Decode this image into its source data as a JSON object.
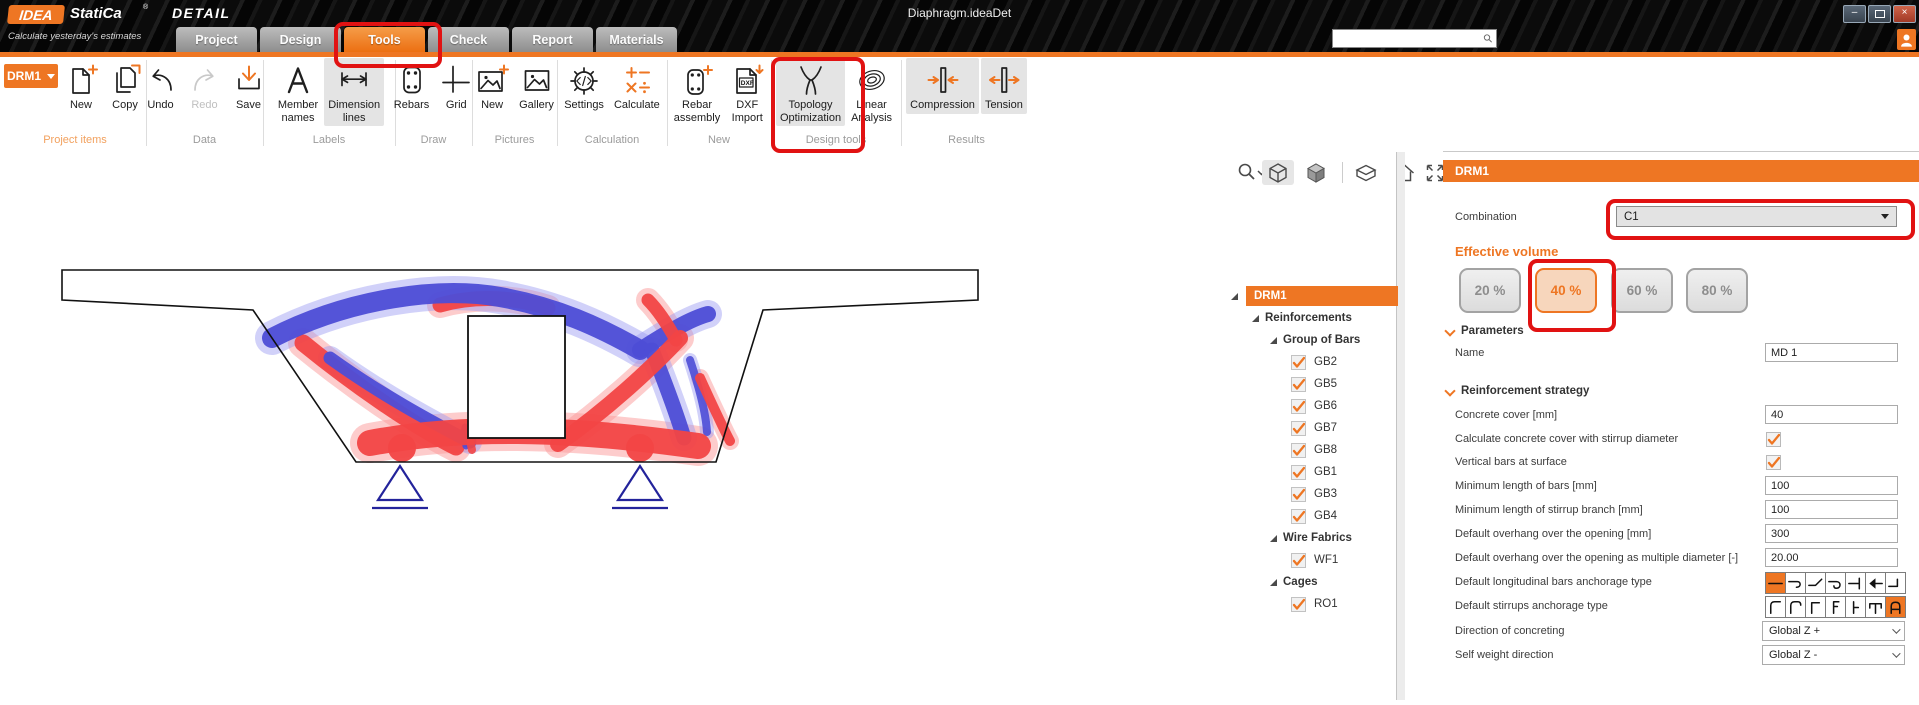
{
  "window": {
    "title": "Diaphragm.ideaDet",
    "controls": [
      {
        "name": "minimize",
        "glyph": "–"
      },
      {
        "name": "maximize",
        "glyph": "box"
      },
      {
        "name": "close",
        "glyph": "×"
      }
    ]
  },
  "brand": {
    "idea": "IDEA",
    "statica": "StatiCa",
    "reg": "®",
    "product": "DETAIL",
    "tagline": "Calculate yesterday's estimates"
  },
  "colors": {
    "accent_orange": "#ee7623",
    "annotation_red": "#e11212",
    "topology_red": "#f24545",
    "topology_blue": "#4d4dd6"
  },
  "tabs": [
    {
      "label": "Project",
      "active": false
    },
    {
      "label": "Design",
      "active": false
    },
    {
      "label": "Tools",
      "active": true
    },
    {
      "label": "Check",
      "active": false
    },
    {
      "label": "Report",
      "active": false
    },
    {
      "label": "Materials",
      "active": false
    }
  ],
  "search": {
    "value": ""
  },
  "ribbon": {
    "groups": [
      {
        "label": "Project items",
        "accent": true,
        "buttons": [
          {
            "label": "DRM1",
            "type": "dropdown"
          },
          {
            "label": "New",
            "icon": "new-document"
          },
          {
            "label": "Copy",
            "icon": "copy-document"
          }
        ]
      },
      {
        "label": "Data",
        "buttons": [
          {
            "label": "Undo",
            "icon": "undo-arrow"
          },
          {
            "label": "Redo",
            "icon": "redo-arrow",
            "disabled": true
          },
          {
            "label": "Save",
            "icon": "save-download"
          }
        ]
      },
      {
        "label": "Labels",
        "buttons": [
          {
            "label": "Member\nnames",
            "icon": "letter-a"
          },
          {
            "label": "Dimension\nlines",
            "icon": "dimension-arrow",
            "highlighted": true
          }
        ]
      },
      {
        "label": "Draw",
        "buttons": [
          {
            "label": "Rebars",
            "icon": "stirrup"
          },
          {
            "label": "Grid",
            "icon": "grid-cross"
          }
        ]
      },
      {
        "label": "Pictures",
        "buttons": [
          {
            "label": "New",
            "icon": "picture-new"
          },
          {
            "label": "Gallery",
            "icon": "picture"
          }
        ]
      },
      {
        "label": "Calculation",
        "buttons": [
          {
            "label": "Settings",
            "icon": "gear-code"
          },
          {
            "label": "Calculate",
            "icon": "math-operators"
          }
        ]
      },
      {
        "label": "New",
        "buttons": [
          {
            "label": "Rebar\nassembly",
            "icon": "stirrup-plus"
          },
          {
            "label": "DXF\nImport",
            "icon": "dxf-file"
          }
        ]
      },
      {
        "label": "Design tools",
        "buttons": [
          {
            "label": "Topology\nOptimization",
            "icon": "topology-branches",
            "highlighted": true
          },
          {
            "label": "Linear\nAnalysis",
            "icon": "concentric-ellipses"
          }
        ]
      },
      {
        "label": "Results",
        "buttons": [
          {
            "label": "Compression",
            "icon": "compression-arrows",
            "highlighted": true
          },
          {
            "label": "Tension",
            "icon": "tension-arrows",
            "highlighted": true
          }
        ]
      }
    ]
  },
  "canvas_toolbar": {
    "icons": [
      "zoom-select",
      "wireframe-cube",
      "solid-cube",
      "clip-box",
      "home",
      "fit-view"
    ],
    "active": "wireframe-cube"
  },
  "tree": {
    "root": {
      "label": "DRM1"
    },
    "items": [
      {
        "label": "Reinforcements",
        "type": "branch",
        "indent": 1
      },
      {
        "label": "Group of Bars",
        "type": "branch",
        "indent": 2
      },
      {
        "label": "GB2",
        "type": "check",
        "checked": true,
        "indent": 3
      },
      {
        "label": "GB5",
        "type": "check",
        "checked": true,
        "indent": 3
      },
      {
        "label": "GB6",
        "type": "check",
        "checked": true,
        "indent": 3
      },
      {
        "label": "GB7",
        "type": "check",
        "checked": true,
        "indent": 3
      },
      {
        "label": "GB8",
        "type": "check",
        "checked": true,
        "indent": 3
      },
      {
        "label": "GB1",
        "type": "check",
        "checked": true,
        "indent": 3
      },
      {
        "label": "GB3",
        "type": "check",
        "checked": true,
        "indent": 3
      },
      {
        "label": "GB4",
        "type": "check",
        "checked": true,
        "indent": 3
      },
      {
        "label": "Wire Fabrics",
        "type": "branch",
        "indent": 2
      },
      {
        "label": "WF1",
        "type": "check",
        "checked": true,
        "indent": 3
      },
      {
        "label": "Cages",
        "type": "branch",
        "indent": 2
      },
      {
        "label": "RO1",
        "type": "check",
        "checked": true,
        "indent": 3
      }
    ]
  },
  "panel": {
    "header": "DRM1",
    "combination": {
      "label": "Combination",
      "value": "C1"
    },
    "effective_volume": {
      "label": "Effective volume",
      "options": [
        {
          "label": "20 %",
          "selected": false
        },
        {
          "label": "40 %",
          "selected": true
        },
        {
          "label": "60 %",
          "selected": false
        },
        {
          "label": "80 %",
          "selected": false
        }
      ]
    },
    "sections": [
      {
        "title": "Parameters",
        "rows": [
          {
            "label": "Name",
            "type": "input",
            "value": "MD 1"
          }
        ]
      },
      {
        "title": "Reinforcement strategy",
        "rows": [
          {
            "label": "Concrete cover [mm]",
            "type": "input",
            "value": "40"
          },
          {
            "label": "Calculate concrete cover with stirrup diameter",
            "type": "check",
            "checked": true
          },
          {
            "label": "Vertical bars at surface",
            "type": "check",
            "checked": true
          },
          {
            "label": "Minimum length of bars [mm]",
            "type": "input",
            "value": "100"
          },
          {
            "label": "Minimum length of stirrup branch [mm]",
            "type": "input",
            "value": "100"
          },
          {
            "label": "Default overhang over the opening [mm]",
            "type": "input",
            "value": "300"
          },
          {
            "label": "Default overhang over the opening as multiple diameter [-]",
            "type": "input",
            "value": "20.00"
          },
          {
            "label": "Default longitudinal bars anchorage type",
            "type": "icon-strip",
            "icons": [
              "straight",
              "hook-90",
              "bend-45",
              "hook-180",
              "end-plate",
              "head-stud",
              "hook-up"
            ],
            "selected": 0
          },
          {
            "label": "Default stirrups anchorage type",
            "type": "icon-strip",
            "icons": [
              "hook-90s",
              "hook-135",
              "corner",
              "double-hook",
              "tick",
              "t-hooks",
              "closed-loop"
            ],
            "selected": 6
          },
          {
            "label": "Direction of concreting",
            "type": "select",
            "value": "Global Z +"
          },
          {
            "label": "Self weight direction",
            "type": "select",
            "value": "Global Z -"
          }
        ]
      }
    ]
  },
  "annotations": [
    "tools-tab",
    "topology-optimization-button",
    "combination-dropdown",
    "volume-40-button"
  ]
}
